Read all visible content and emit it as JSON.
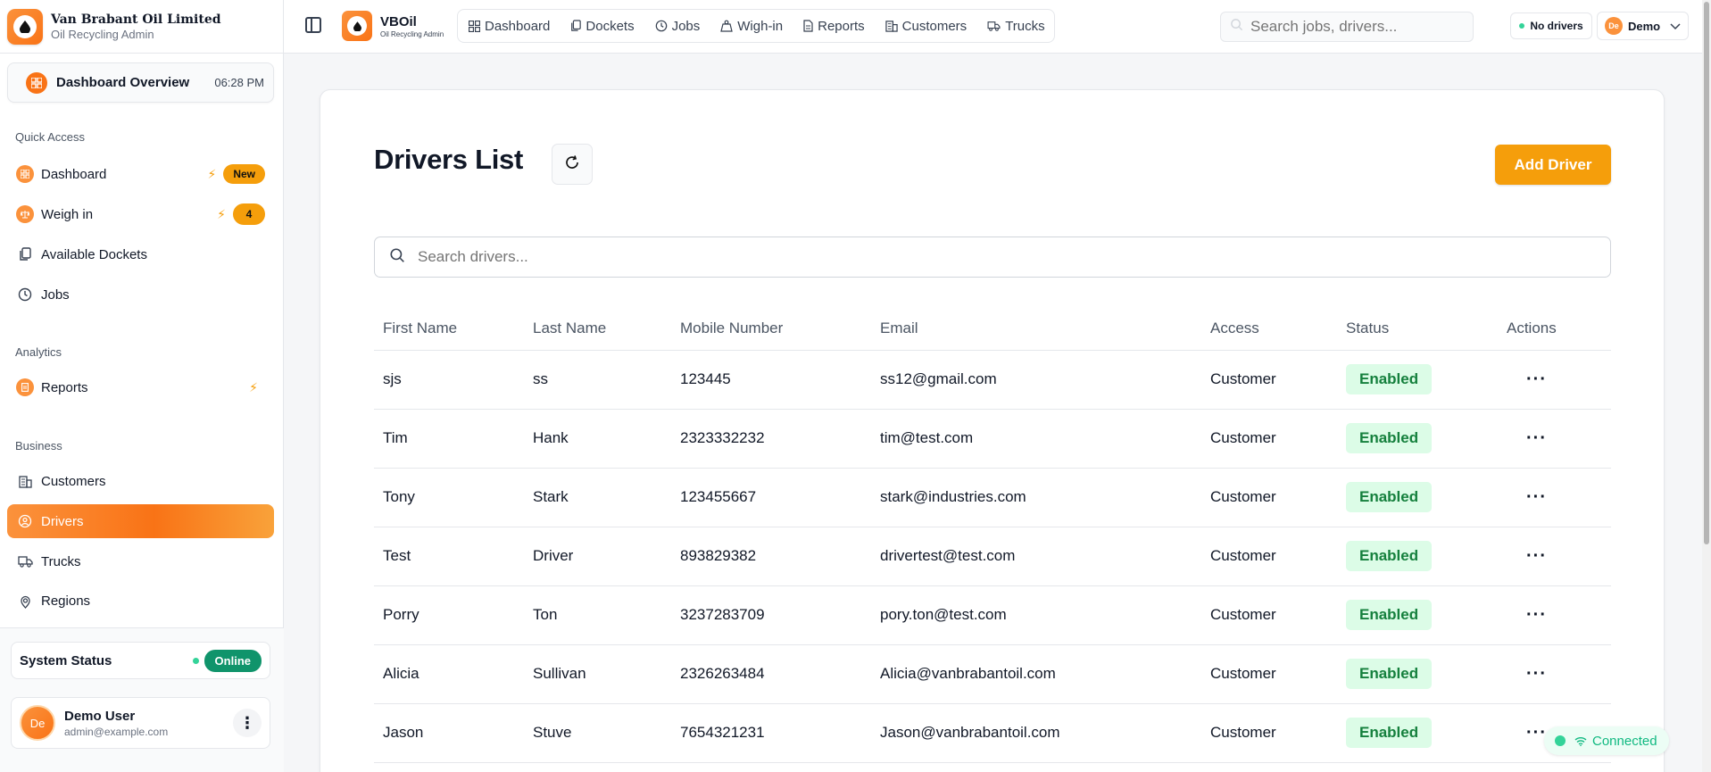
{
  "brand": {
    "title": "Van Brabant Oil Limited",
    "subtitle": "Oil Recycling Admin"
  },
  "overview": {
    "label": "Dashboard Overview",
    "time": "06:28 PM"
  },
  "sidebar": {
    "sections": [
      {
        "label": "Quick Access"
      },
      {
        "label": "Analytics"
      },
      {
        "label": "Business"
      }
    ],
    "items": [
      {
        "label": "Dashboard",
        "badge": "New"
      },
      {
        "label": "Weigh in",
        "badge": "4"
      },
      {
        "label": "Available Dockets"
      },
      {
        "label": "Jobs"
      },
      {
        "label": "Reports"
      },
      {
        "label": "Customers"
      },
      {
        "label": "Drivers"
      },
      {
        "label": "Trucks"
      },
      {
        "label": "Regions"
      }
    ],
    "status": {
      "label": "System Status",
      "value": "Online"
    },
    "user": {
      "initials": "De",
      "name": "Demo User",
      "email": "admin@example.com"
    }
  },
  "topbar": {
    "app_name": "VBOil",
    "app_sub": "Oil Recycling Admin",
    "nav": [
      {
        "label": "Dashboard",
        "icon": "grid-icon"
      },
      {
        "label": "Dockets",
        "icon": "copy-icon"
      },
      {
        "label": "Jobs",
        "icon": "clock-icon"
      },
      {
        "label": "Wigh-in",
        "icon": "weight-icon"
      },
      {
        "label": "Reports",
        "icon": "file-icon"
      },
      {
        "label": "Customers",
        "icon": "building-icon"
      },
      {
        "label": "Trucks",
        "icon": "truck-icon"
      }
    ],
    "search_placeholder": "Search jobs, drivers...",
    "driver_status": "No drivers",
    "account": {
      "initials": "De",
      "label": "Demo"
    }
  },
  "main": {
    "title": "Drivers List",
    "add_button": "Add Driver",
    "search_placeholder": "Search drivers...",
    "columns": [
      "First Name",
      "Last Name",
      "Mobile Number",
      "Email",
      "Access",
      "Status",
      "Actions"
    ],
    "rows": [
      {
        "first": "sjs",
        "last": "ss",
        "mobile": "123445",
        "email": "ss12@gmail.com",
        "access": "Customer",
        "status": "Enabled"
      },
      {
        "first": "Tim",
        "last": "Hank",
        "mobile": "2323332232",
        "email": "tim@test.com",
        "access": "Customer",
        "status": "Enabled"
      },
      {
        "first": "Tony",
        "last": "Stark",
        "mobile": "123455667",
        "email": "stark@industries.com",
        "access": "Customer",
        "status": "Enabled"
      },
      {
        "first": "Test",
        "last": "Driver",
        "mobile": "893829382",
        "email": "drivertest@test.com",
        "access": "Customer",
        "status": "Enabled"
      },
      {
        "first": "Porry",
        "last": "Ton",
        "mobile": "3237283709",
        "email": "pory.ton@test.com",
        "access": "Customer",
        "status": "Enabled"
      },
      {
        "first": "Alicia",
        "last": "Sullivan",
        "mobile": "2326263484",
        "email": "Alicia@vanbrabantoil.com",
        "access": "Customer",
        "status": "Enabled"
      },
      {
        "first": "Jason",
        "last": "Stuve",
        "mobile": "7654321231",
        "email": "Jason@vanbrabantoil.com",
        "access": "Customer",
        "status": "Enabled"
      }
    ],
    "row_action": "···"
  },
  "connection": {
    "label": "Connected"
  },
  "colors": {
    "accent": "#f59e0b",
    "brand": "#f97316",
    "success": "#15803d"
  }
}
